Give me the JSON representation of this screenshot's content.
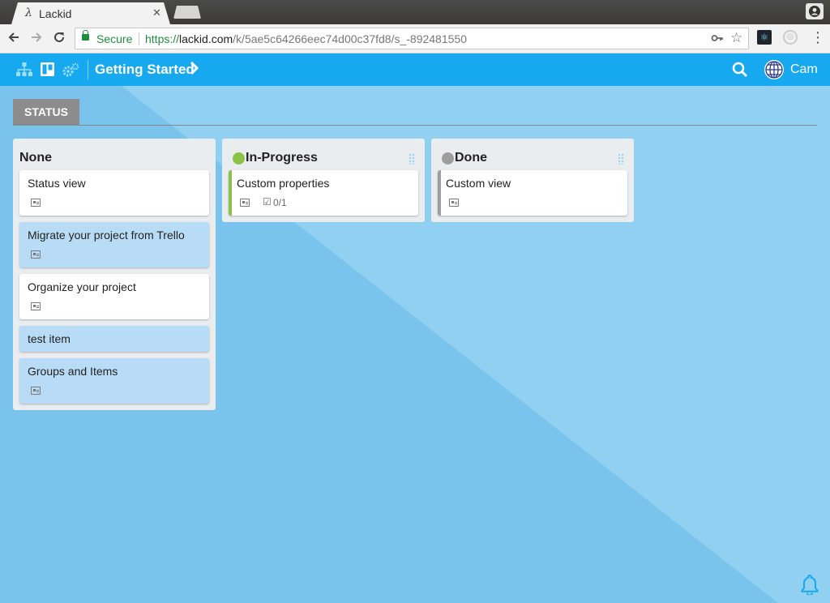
{
  "browser": {
    "tab_title": "Lackid",
    "tab_favicon": "λ",
    "tab_close": "✕",
    "secure_label": "Secure",
    "url_scheme": "https://",
    "url_host": "lackid.com",
    "url_path": "/k/5ae5c64266eec74d00c37fd8/s_-892481550"
  },
  "app": {
    "board_title": "Getting Started",
    "user_name": "Cam",
    "accent": "#16a9ef"
  },
  "status_tab": "STATUS",
  "columns": [
    {
      "title": "None",
      "cards": [
        {
          "title": "Status view"
        },
        {
          "title": "Migrate your project from Trello"
        },
        {
          "title": "Organize your project"
        },
        {
          "title": "test item"
        },
        {
          "title": "Groups and Items"
        }
      ]
    },
    {
      "title": "In-Progress",
      "dot_color": "#8bc34a",
      "cards": [
        {
          "title": "Custom properties",
          "checklist": "0/1"
        }
      ]
    },
    {
      "title": "Done",
      "dot_color": "#9e9e9e",
      "cards": [
        {
          "title": "Custom view"
        }
      ]
    }
  ],
  "icons": [
    "hierarchy-icon",
    "board-icon",
    "settings-icon",
    "chevron-right-icon",
    "search-icon",
    "notification-bell-icon"
  ]
}
